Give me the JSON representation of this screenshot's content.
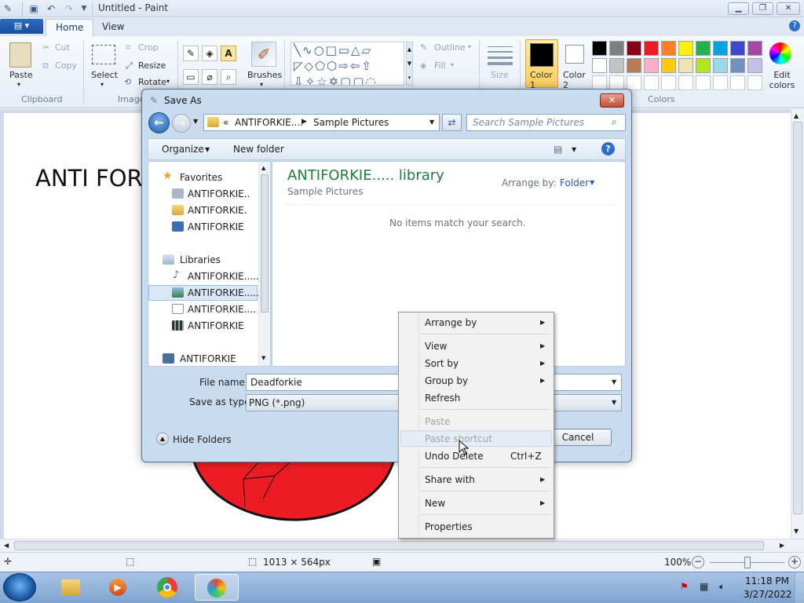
{
  "window": {
    "title": "Untitled - Paint"
  },
  "ribbon": {
    "tabs": [
      "Home",
      "View"
    ],
    "clipboard": {
      "paste": "Paste",
      "cut": "Cut",
      "copy": "Copy",
      "label": "Clipboard"
    },
    "image": {
      "select": "Select",
      "crop": "Crop",
      "resize": "Resize",
      "rotate": "Rotate",
      "label": "Image"
    },
    "tools": {
      "brushes": "Brushes"
    },
    "shapes": {
      "outline": "Outline",
      "fill": "Fill"
    },
    "size": "Size",
    "color1": "Color 1",
    "color2": "Color 2",
    "colors_label": "Colors",
    "edit_colors": "Edit colors",
    "palette": [
      "#000000",
      "#7f7f7f",
      "#880015",
      "#ed1c24",
      "#ff7f27",
      "#fff200",
      "#22b14c",
      "#00a2e8",
      "#3f48cc",
      "#a349a4",
      "#ffffff",
      "#c3c3c3",
      "#b97a57",
      "#ffaec9",
      "#ffc90e",
      "#efe4b0",
      "#b5e61d",
      "#99d9ea",
      "#7092be",
      "#c8bfe7"
    ]
  },
  "canvas": {
    "text": "ANTI FOR",
    "circle_color": "#ed1c24"
  },
  "dialog": {
    "title": "Save As",
    "address": {
      "root": "«",
      "parent": "ANTIFORKIE....",
      "current": "Sample Pictures"
    },
    "search_placeholder": "Search Sample Pictures",
    "toolbar": {
      "organize": "Organize",
      "new_folder": "New folder"
    },
    "nav": {
      "favorites": "Favorites",
      "fav_items": [
        "ANTIFORKIE..",
        "ANTIFORKIE.",
        "ANTIFORKIE"
      ],
      "libraries": "Libraries",
      "lib_items": [
        "ANTIFORKIE......",
        "ANTIFORKIE.....",
        "ANTIFORKIE....",
        "ANTIFORKIE"
      ],
      "computer": "ANTIFORKIE"
    },
    "content": {
      "title": "ANTIFORKIE..... library",
      "subtitle": "Sample Pictures",
      "arrange_label": "Arrange by:",
      "arrange_value": "Folder",
      "empty": "No items match your search."
    },
    "file_name_label": "File name:",
    "file_name_value": "Deadforkie",
    "save_type_label": "Save as type:",
    "save_type_value": "PNG (*.png)",
    "hide_folders": "Hide Folders",
    "cancel": "Cancel"
  },
  "context_menu": {
    "arrange_by": "Arrange by",
    "view": "View",
    "sort_by": "Sort by",
    "group_by": "Group by",
    "refresh": "Refresh",
    "paste": "Paste",
    "paste_shortcut": "Paste shortcut",
    "undo_delete": "Undo Delete",
    "undo_shortcut": "Ctrl+Z",
    "share_with": "Share with",
    "new": "New",
    "properties": "Properties"
  },
  "status": {
    "dimensions": "1013 × 564px",
    "zoom": "100%",
    "zoom_level": 1.0
  },
  "taskbar": {
    "time": "11:18 PM",
    "date": "3/27/2022"
  }
}
